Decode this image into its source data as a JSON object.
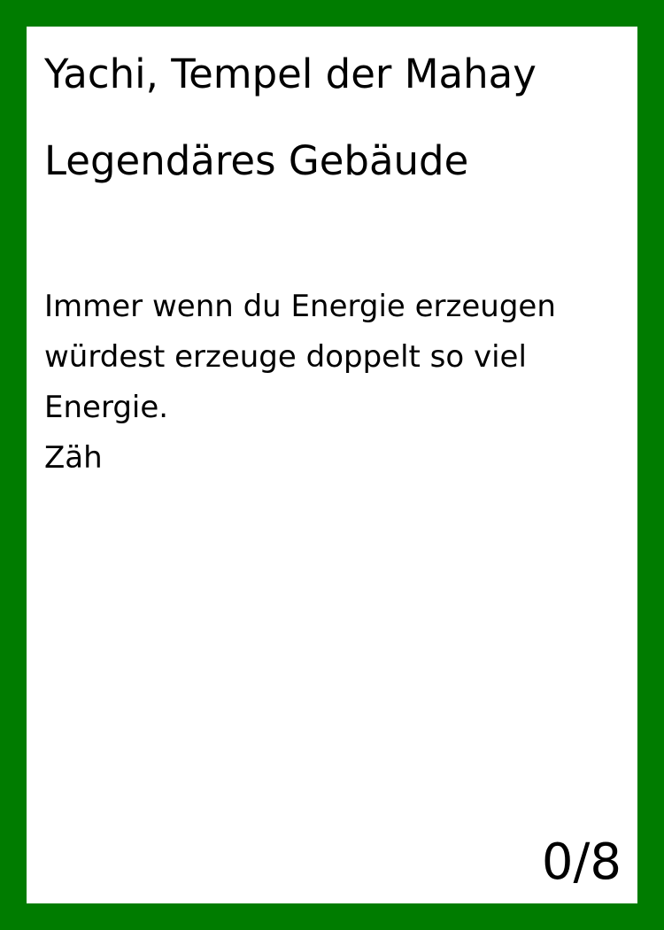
{
  "card": {
    "name": "Yachi, Tempel der Mahay",
    "type": "Legendäres Gebäude",
    "rules_text": "Immer wenn du Energie erzeugen würdest erzeuge doppelt so viel Energie.",
    "keyword": "Zäh",
    "stats": "0/8",
    "border_color": "#007c00"
  }
}
